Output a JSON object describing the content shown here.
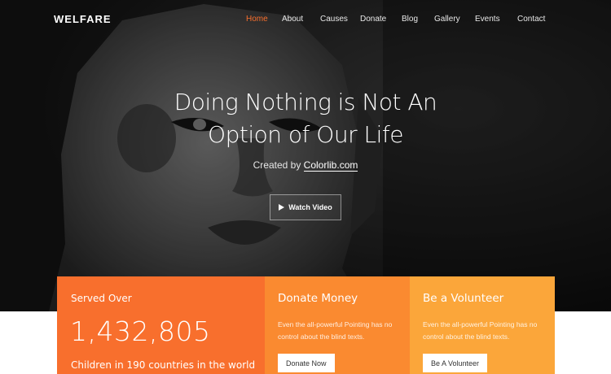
{
  "brand": "WELFARE",
  "nav": [
    "Home",
    "About",
    "Causes",
    "Donate",
    "Blog",
    "Gallery",
    "Events",
    "Contact"
  ],
  "nav_active": "Home",
  "hero": {
    "title_line1": "Doing Nothing is Not An",
    "title_line2": "Option of Our Life",
    "sub_prefix": "Created by ",
    "sub_link": "Colorlib.com",
    "watch_label": "Watch Video"
  },
  "stats": {
    "label": "Served Over",
    "number": "1,432,805",
    "footnote": "Children in 190 countries in the world"
  },
  "donate": {
    "title": "Donate Money",
    "text": "Even the all-powerful Pointing has no control about the blind texts.",
    "button": "Donate Now"
  },
  "volunteer": {
    "title": "Be a Volunteer",
    "text": "Even the all-powerful Pointing has no control about the blind texts.",
    "button": "Be A Volunteer"
  },
  "colors": {
    "accent": "#f86f2d",
    "card_1": "#f86f2d",
    "card_2": "#fa8a30",
    "card_3": "#fba63a"
  }
}
